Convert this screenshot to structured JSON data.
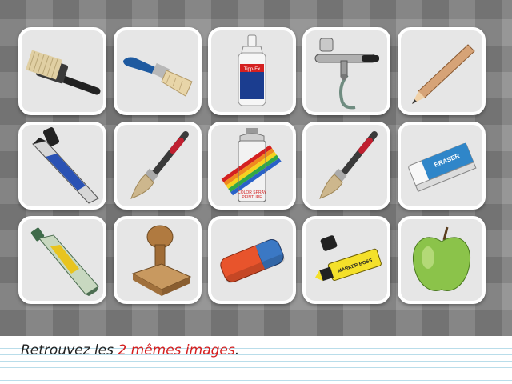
{
  "game": {
    "instruction_prefix": "Retrouvez les ",
    "instruction_highlight": "2 mêmes images",
    "instruction_suffix": ".",
    "highlight_color": "#d42020",
    "cards": [
      {
        "row": 1,
        "col": 1,
        "item": "wallpaper-brush-icon"
      },
      {
        "row": 1,
        "col": 2,
        "item": "flat-paintbrush-icon"
      },
      {
        "row": 1,
        "col": 3,
        "item": "correction-fluid-bottle-icon",
        "text": "Tipp-Ex"
      },
      {
        "row": 1,
        "col": 4,
        "item": "airbrush-icon"
      },
      {
        "row": 1,
        "col": 5,
        "item": "wooden-pencil-icon"
      },
      {
        "row": 2,
        "col": 1,
        "item": "permanent-marker-icon"
      },
      {
        "row": 2,
        "col": 2,
        "item": "round-paintbrush-icon"
      },
      {
        "row": 2,
        "col": 3,
        "item": "spray-paint-can-icon",
        "text": "COLOR SPRAY PEINTURE"
      },
      {
        "row": 2,
        "col": 4,
        "item": "round-paintbrush-icon"
      },
      {
        "row": 2,
        "col": 5,
        "item": "eraser-icon",
        "text": "ERASER"
      },
      {
        "row": 3,
        "col": 1,
        "item": "glue-tube-icon"
      },
      {
        "row": 3,
        "col": 2,
        "item": "rubber-stamp-icon"
      },
      {
        "row": 3,
        "col": 3,
        "item": "red-blue-eraser-icon"
      },
      {
        "row": 3,
        "col": 4,
        "item": "highlighter-icon",
        "text": "MARKER BOSS"
      },
      {
        "row": 3,
        "col": 5,
        "item": "green-apple-icon"
      }
    ]
  }
}
